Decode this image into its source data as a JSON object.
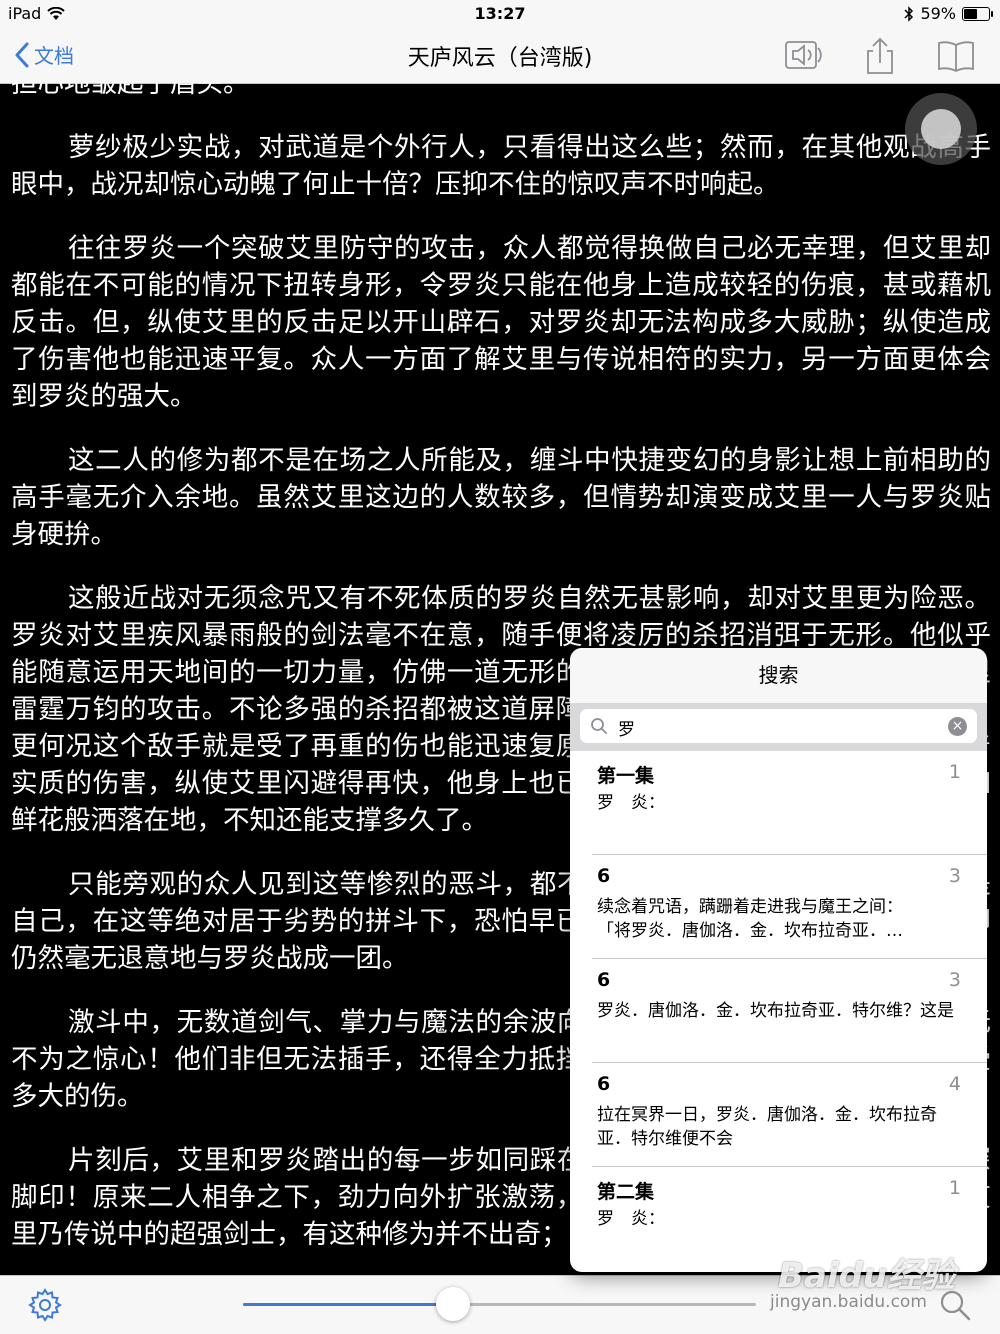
{
  "status_bar": {
    "device": "iPad",
    "time": "13:27",
    "battery_text": "59%",
    "battery_level": 0.59
  },
  "nav": {
    "back_label": "文档",
    "title": "天庐风云（台湾版)"
  },
  "reader": {
    "paragraphs": [
      "担心地皱起了眉头。",
      "萝纱极少实战，对武道是个外行人，只看得出这么些；然而，在其他观战高手眼中，战况却惊心动魄了何止十倍？压抑不住的惊叹声不时响起。",
      "往往罗炎一个突破艾里防守的攻击，众人都觉得换做自己必无幸理，但艾里却都能在不可能的情况下扭转身形，令罗炎只能在他身上造成较轻的伤痕，甚或藉机反击。但，纵使艾里的反击足以开山辟石，对罗炎却无法构成多大威胁；纵使造成了伤害他也能迅速平复。众人一方面了解艾里与传说相符的实力，另一方面更体会到罗炎的强大。",
      "这二人的修为都不是在场之人所能及，缠斗中快捷变幻的身影让想上前相助的高手毫无介入余地。虽然艾里这边的人数较多，但情势却演变成艾里一人与罗炎贴身硬拚。",
      "这般近战对无须念咒又有不死体质的罗炎自然无甚影响，却对艾里更为险恶。罗炎对艾里疾风暴雨般的剑法毫不在意，随手便将凌厉的杀招消弭于无形。他似乎能随意运用天地间的一切力量，仿佛一道无形的屏障般，化作重重光幕来挡住艾里雷霆万钧的攻击。不论多强的杀招都被这道屏障无声化解，又有何威胁性可言呢？更何况这个敌手就是受了再重的伤也能迅速复原；反而，罗炎对艾里的攻击却有着实质的伤害，纵使艾里闪避得再快，他身上也已大小伤痕无数，鲜血点点滴溅，如鲜花般洒落在地，不知还能支撑多久了。",
      "只能旁观的众人见到这等惨烈的恶斗，都不禁心惊胆跳，若是与罗炎对战的是自己，在这等绝对居于劣势的拼斗下，恐怕早已丧命；艾里受了这般严重的伤，却仍然毫无退意地与罗炎战成一团。",
      "激斗中，无数道剑气、掌力与魔法的余波向四面八方激射，令观战的众高手无不为之惊心！他们非但无法插手，还得全力抵挡这些余波，幸而反应及时，没有受多大的伤。",
      "片刻后，艾里和罗炎踏出的每一步如同踩在泥地上一般，留下一个个深深的深脚印！原来二人相争之下，劲力向外扩张激荡，竟将脚下坚硬的石地化为粉末。艾里乃传说中的超强剑士，有这种修为并不出奇；"
    ]
  },
  "toolbar": {
    "progress": 0.41
  },
  "search": {
    "title": "搜索",
    "query": "罗",
    "results": [
      {
        "title": "第一集",
        "page": "1",
        "excerpt": "罗　炎："
      },
      {
        "title": "6",
        "page": "3",
        "excerpt": "续念着咒语，蹒跚着走进我与魔王之间：\n「将罗炎．唐伽洛．金．坎布拉奇亚．…"
      },
      {
        "title": "6",
        "page": "3",
        "excerpt": "罗炎．唐伽洛．金．坎布拉奇亚．特尔维？这是"
      },
      {
        "title": "6",
        "page": "4",
        "excerpt": "拉在冥界一日，罗炎．唐伽洛．金．坎布拉奇亚．特尔维便不会"
      },
      {
        "title": "第二集",
        "page": "1",
        "excerpt": "罗　炎："
      }
    ]
  },
  "watermark": {
    "brand": "Baidu经验",
    "url": "jingyan.baidu.com"
  },
  "colors": {
    "accent": "#3d7bd6",
    "bar_bg": "#f7f7f7",
    "reader_bg": "#000000",
    "reader_text": "#ffffff"
  }
}
